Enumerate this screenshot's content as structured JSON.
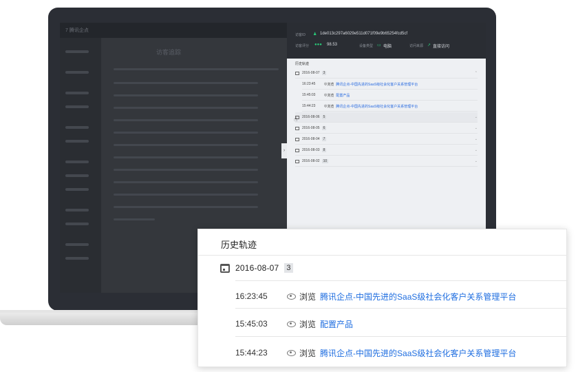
{
  "dashboard": {
    "logo": "7 腾讯企点",
    "title": "访客追踪"
  },
  "drawer": {
    "visitor_id_label": "访客ID",
    "visitor_id": "1de013c297a6029e511d071f09e9b65254fcd5cf",
    "score_label": "访客评分",
    "score": "98.53",
    "device_label": "设备类型",
    "device": "电脑",
    "source_label": "访问来源",
    "source": "直接访问",
    "handle_icon": "chevron-right-icon",
    "section_title": "历史轨迹",
    "days": [
      {
        "date": "2016-08-07",
        "count": "3",
        "expanded": true
      },
      {
        "date": "2016-08-06",
        "count": "5"
      },
      {
        "date": "2016-08-05",
        "count": "6"
      },
      {
        "date": "2016-08-04",
        "count": "7"
      },
      {
        "date": "2016-08-03",
        "count": "8"
      },
      {
        "date": "2016-08-02",
        "count": "10"
      }
    ]
  },
  "history": {
    "title": "历史轨迹",
    "date": "2016-08-07",
    "count": "3",
    "entries": [
      {
        "time": "16:23:45",
        "action": "浏览",
        "page": "腾讯企点-中国先进的SaaS级社会化客户关系管理平台"
      },
      {
        "time": "15:45:03",
        "action": "浏览",
        "page": "配置产品"
      },
      {
        "time": "15:44:23",
        "action": "浏览",
        "page": "腾讯企点-中国先进的SaaS级社会化客户关系管理平台"
      }
    ]
  },
  "colors": {
    "link": "#1f6ee0",
    "accent_green": "#29cc7a",
    "drawer_header": "#2a2d33"
  },
  "icons": [
    "calendar-icon",
    "eye-icon",
    "person-icon",
    "monitor-icon",
    "arrow-icon",
    "cursor-icon"
  ]
}
